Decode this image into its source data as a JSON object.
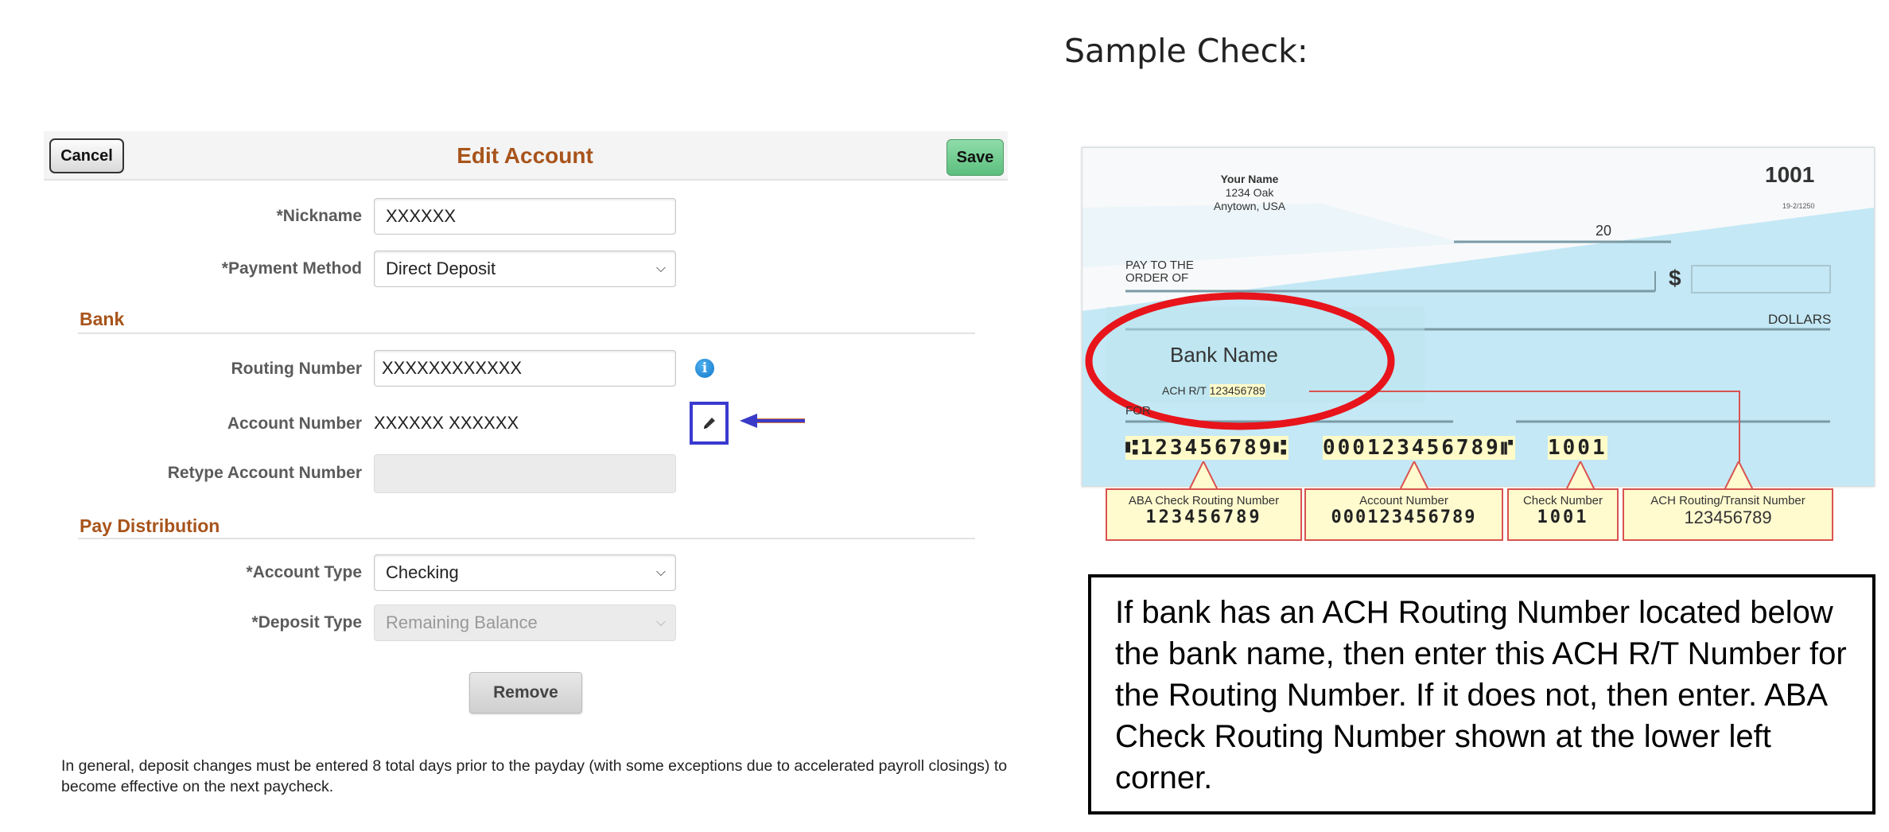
{
  "form": {
    "header": {
      "title": "Edit Account",
      "cancel_label": "Cancel",
      "save_label": "Save"
    },
    "fields": {
      "nickname": {
        "label": "*Nickname",
        "value": "XXXXXX"
      },
      "payment_method": {
        "label": "*Payment Method",
        "value": "Direct Deposit"
      },
      "routing_number": {
        "label": "Routing Number",
        "value": "XXXXXXXXXXXX"
      },
      "account_number": {
        "label": "Account Number",
        "value": "XXXXXX XXXXXX"
      },
      "retype_account_number": {
        "label": "Retype Account Number",
        "value": ""
      },
      "account_type": {
        "label": "*Account Type",
        "value": "Checking"
      },
      "deposit_type": {
        "label": "*Deposit Type",
        "value": "Remaining Balance"
      }
    },
    "sections": {
      "bank": "Bank",
      "pay_distribution": "Pay Distribution"
    },
    "icons": {
      "info": "info-icon",
      "edit": "pencil-icon",
      "arrow": "arrow-left-icon"
    },
    "remove_label": "Remove",
    "footnote": "In general, deposit changes must be entered 8 total days prior to the payday (with some exceptions due to accelerated payroll closings) to become effective on the next paycheck."
  },
  "sample_check": {
    "title": "Sample Check:",
    "check": {
      "name": "Your Name",
      "address1": "1234 Oak",
      "address2": "Anytown, USA",
      "check_number": "1001",
      "fraction": "19-2/1250",
      "date_suffix": "20",
      "pay_to": "PAY TO THE",
      "order_of": "ORDER OF",
      "dollar_sign": "$",
      "dollars": "DOLLARS",
      "bank_name": "Bank Name",
      "ach_label": "ACH R/T",
      "ach_number": "123456789",
      "memo": "FOR",
      "micr_routing": "⑆123456789⑆",
      "micr_account": "000123456789⑈",
      "micr_check": "1001"
    },
    "callouts": [
      {
        "label": "ABA Check Routing Number",
        "value": "123456789"
      },
      {
        "label": "Account Number",
        "value": "000123456789"
      },
      {
        "label": "Check Number",
        "value": "1001"
      },
      {
        "label": "ACH Routing/Transit Number",
        "value": "123456789"
      }
    ],
    "highlight_color": "#e8141b"
  },
  "instruction_text": "If bank has an ACH Routing Number located below the bank name, then enter this ACH R/T Number for the Routing Number.  If it does not, then enter. ABA Check Routing Number shown at the lower left corner."
}
